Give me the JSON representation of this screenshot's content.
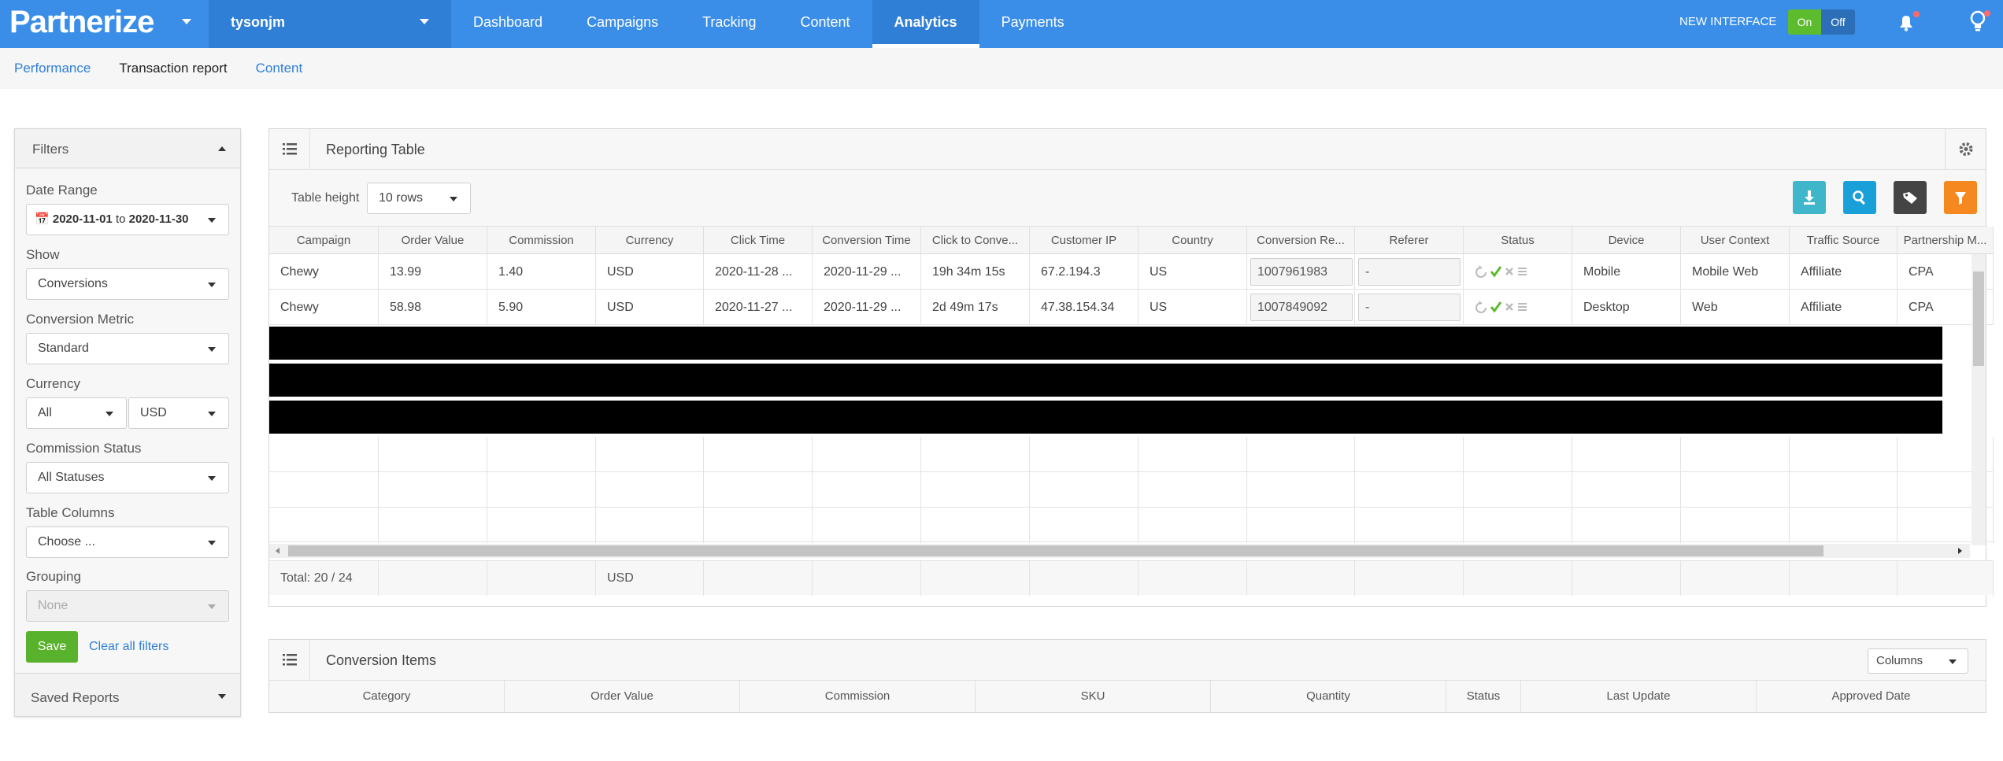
{
  "brand": {
    "logo_text": "Partnerize",
    "account": "tysonjm"
  },
  "nav": {
    "items": [
      {
        "label": "Dashboard",
        "active": false
      },
      {
        "label": "Campaigns",
        "active": false
      },
      {
        "label": "Tracking",
        "active": false
      },
      {
        "label": "Content",
        "active": false
      },
      {
        "label": "Analytics",
        "active": true
      },
      {
        "label": "Payments",
        "active": false
      }
    ],
    "new_interface_label": "NEW INTERFACE",
    "toggle_on": "On",
    "toggle_off": "Off"
  },
  "subnav": {
    "items": [
      "Performance",
      "Transaction report",
      "Content"
    ]
  },
  "filters": {
    "title": "Filters",
    "date_range_label": "Date Range",
    "date_from": "2020-11-01",
    "date_to_word": "to",
    "date_to": "2020-11-30",
    "show_label": "Show",
    "show_value": "Conversions",
    "conversion_metric_label": "Conversion Metric",
    "conversion_metric_value": "Standard",
    "currency_label": "Currency",
    "currency_scope": "All",
    "currency_value": "USD",
    "commission_status_label": "Commission Status",
    "commission_status_value": "All Statuses",
    "table_columns_label": "Table Columns",
    "table_columns_placeholder": "Choose ...",
    "grouping_label": "Grouping",
    "grouping_value": "None",
    "save_label": "Save",
    "clear_label": "Clear all filters",
    "saved_reports_label": "Saved Reports"
  },
  "reporting": {
    "title": "Reporting Table",
    "table_height_label": "Table height",
    "table_height_value": "10 rows",
    "columns": [
      "Campaign",
      "Order Value",
      "Commission",
      "Currency",
      "Click Time",
      "Conversion Time",
      "Click to Conve...",
      "Customer IP",
      "Country",
      "Conversion Re...",
      "Referer",
      "Status",
      "Device",
      "User Context",
      "Traffic Source",
      "Partnership M..."
    ],
    "rows": [
      {
        "campaign": "Chewy",
        "order_value": "13.99",
        "commission": "1.40",
        "currency": "USD",
        "click_time": "2020-11-28 ...",
        "conversion_time": "2020-11-29 ...",
        "click_to_conversion": "19h 34m 15s",
        "customer_ip": "67.2.194.3",
        "country": "US",
        "conversion_ref": "1007961983",
        "referer": "-",
        "device": "Mobile",
        "user_context": "Mobile Web",
        "traffic_source": "Affiliate",
        "partnership_model": "CPA"
      },
      {
        "campaign": "Chewy",
        "order_value": "58.98",
        "commission": "5.90",
        "currency": "USD",
        "click_time": "2020-11-27 ...",
        "conversion_time": "2020-11-29 ...",
        "click_to_conversion": "2d 49m 17s",
        "customer_ip": "47.38.154.34",
        "country": "US",
        "conversion_ref": "1007849092",
        "referer": "-",
        "device": "Desktop",
        "user_context": "Web",
        "traffic_source": "Affiliate",
        "partnership_model": "CPA"
      }
    ],
    "total_label": "Total: 20 / 24",
    "total_currency": "USD"
  },
  "conversion_items": {
    "title": "Conversion Items",
    "columns_button": "Columns",
    "columns": [
      "Category",
      "Order Value",
      "Commission",
      "SKU",
      "Quantity",
      "Status",
      "Last Update",
      "Approved Date"
    ]
  },
  "colors": {
    "brand_blue": "#3a8ee8",
    "export_button": "#3fb6c9",
    "search_button": "#1aa0d8",
    "tag_button": "#444444",
    "filter_button": "#f5891f",
    "save_button": "#58b22b",
    "approve_check": "#5dbb2e"
  },
  "icons": [
    "list-icon",
    "gear-icon",
    "download-icon",
    "search-icon",
    "tag-icon",
    "filter-icon",
    "calendar-icon",
    "bell-icon",
    "lightbulb-icon",
    "refresh-icon",
    "check-icon",
    "cross-icon",
    "menu-icon"
  ]
}
